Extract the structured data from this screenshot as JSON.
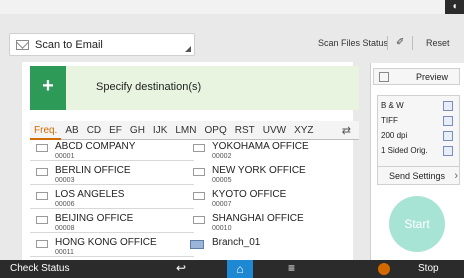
{
  "mode_select": {
    "label": "Scan to Email"
  },
  "header": {
    "scan_status": "Scan Files Status",
    "reset": "Reset"
  },
  "destination": {
    "specify_label": "Specify destination(s)",
    "plus": "+"
  },
  "tabs": [
    "Freq.",
    "AB",
    "CD",
    "EF",
    "GH",
    "IJK",
    "LMN",
    "OPQ",
    "RST",
    "UVW",
    "XYZ"
  ],
  "destinations": [
    {
      "name": "ABCD COMPANY",
      "num": "00001"
    },
    {
      "name": "YOKOHAMA OFFICE",
      "num": "00002"
    },
    {
      "name": "BERLIN OFFICE",
      "num": "00003"
    },
    {
      "name": "NEW YORK OFFICE",
      "num": "00005"
    },
    {
      "name": "LOS ANGELES",
      "num": "00006"
    },
    {
      "name": "KYOTO OFFICE",
      "num": "00007"
    },
    {
      "name": "BEIJING OFFICE",
      "num": "00008"
    },
    {
      "name": "SHANGHAI  OFFICE",
      "num": "00010"
    },
    {
      "name": "HONG KONG OFFICE",
      "num": "00011"
    },
    {
      "name": "Branch_01",
      "num": ""
    }
  ],
  "preview": {
    "label": "Preview"
  },
  "settings": {
    "color": "B & W",
    "format": "TIFF",
    "resolution": "200 dpi",
    "orig": "1 Sided Orig.",
    "send_settings": "Send Settings"
  },
  "start": {
    "label": "Start"
  },
  "bottom": {
    "check_status": "Check Status",
    "stop": "Stop"
  },
  "colors": {
    "accent_green": "#2d9a57",
    "freq_orange": "#d26a00",
    "home_blue": "#1e88d2",
    "start_teal": "#a8e4d6"
  }
}
